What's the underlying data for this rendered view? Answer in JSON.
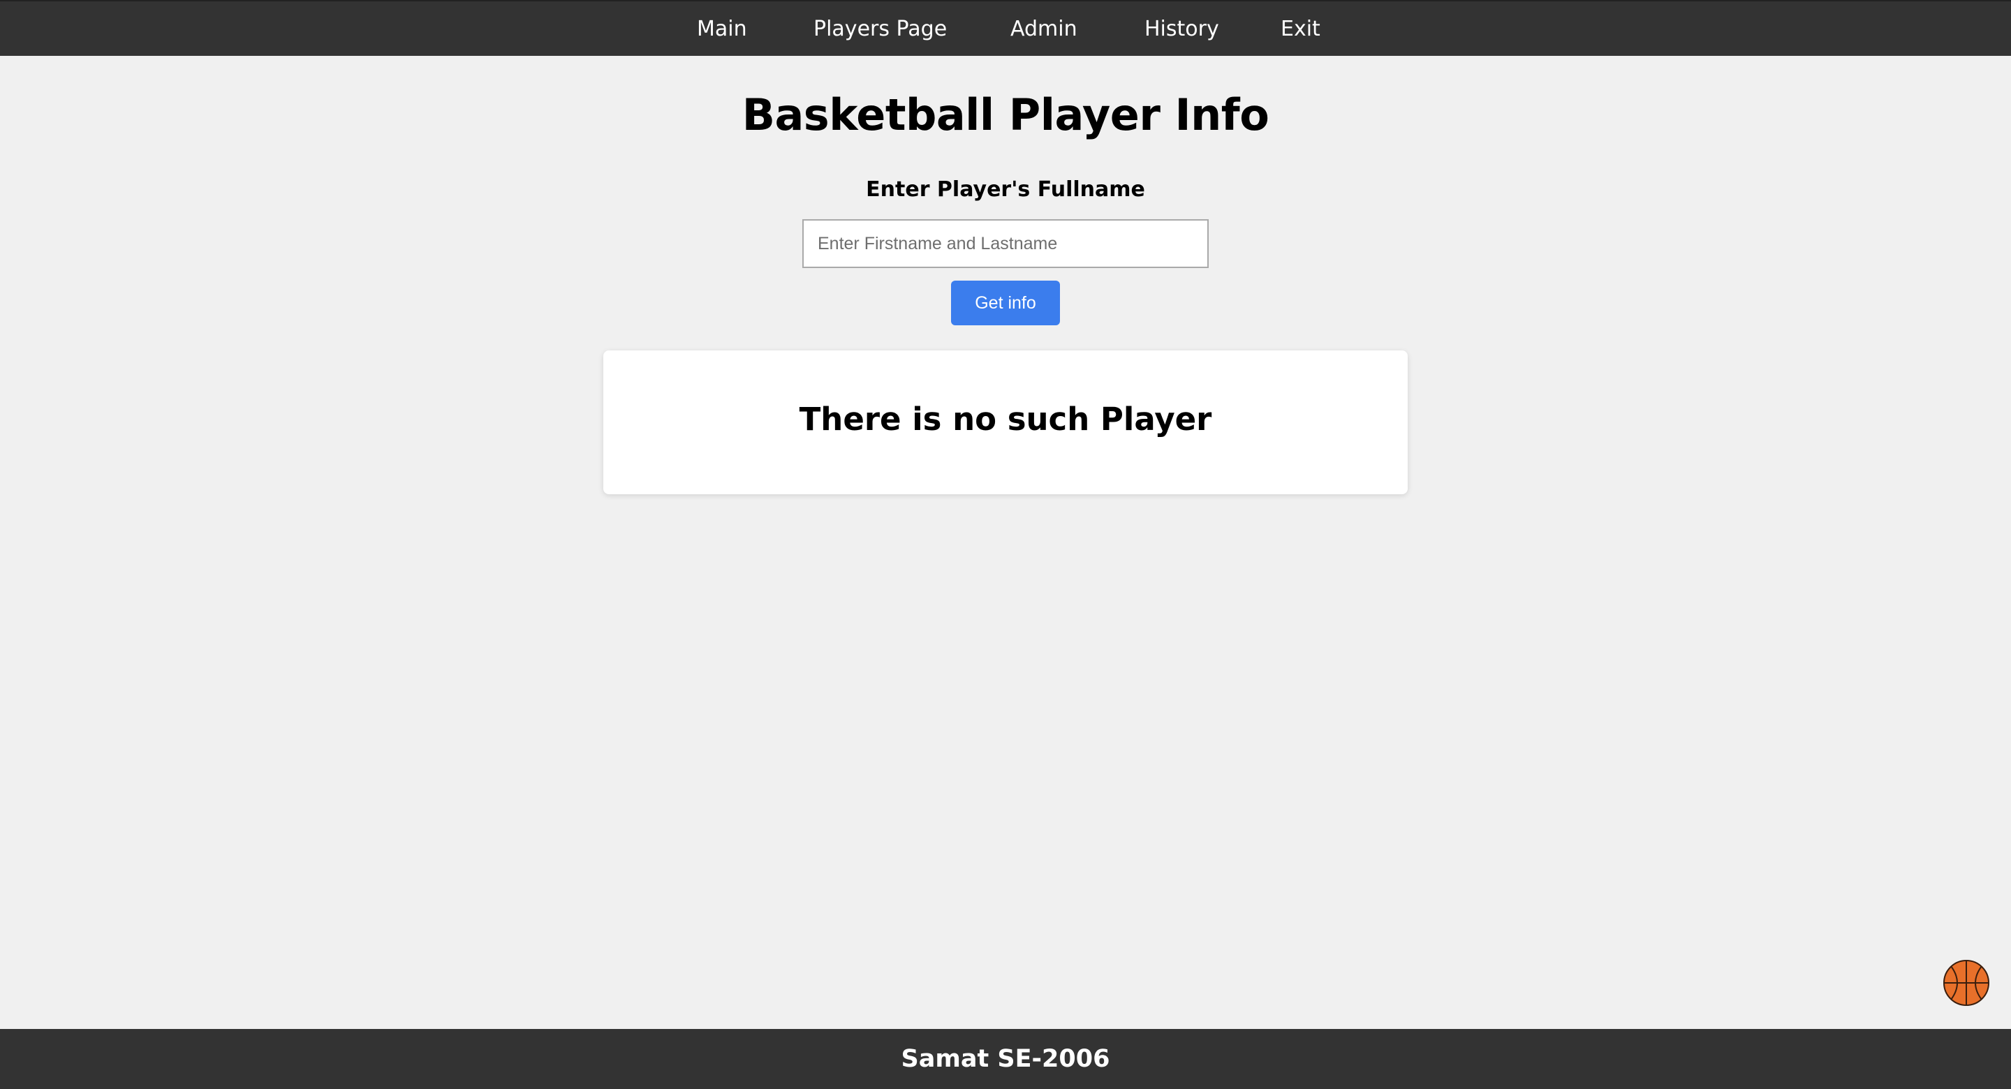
{
  "nav": {
    "items": [
      {
        "label": "Main"
      },
      {
        "label": "Players Page"
      },
      {
        "label": "Admin"
      },
      {
        "label": "History"
      },
      {
        "label": "Exit"
      }
    ]
  },
  "header": {
    "title": "Basketball Player Info"
  },
  "form": {
    "label": "Enter Player's Fullname",
    "input_value": "",
    "input_placeholder": "Enter Firstname and Lastname",
    "button_label": "Get info"
  },
  "result": {
    "message": "There is no such Player"
  },
  "footer": {
    "text": "Samat SE-2006"
  },
  "icons": {
    "floating": "basketball-icon"
  },
  "colors": {
    "navbar_bg": "#333333",
    "page_bg": "#f0f0f0",
    "button_bg": "#3b7ded",
    "ball": "#e8702a"
  }
}
